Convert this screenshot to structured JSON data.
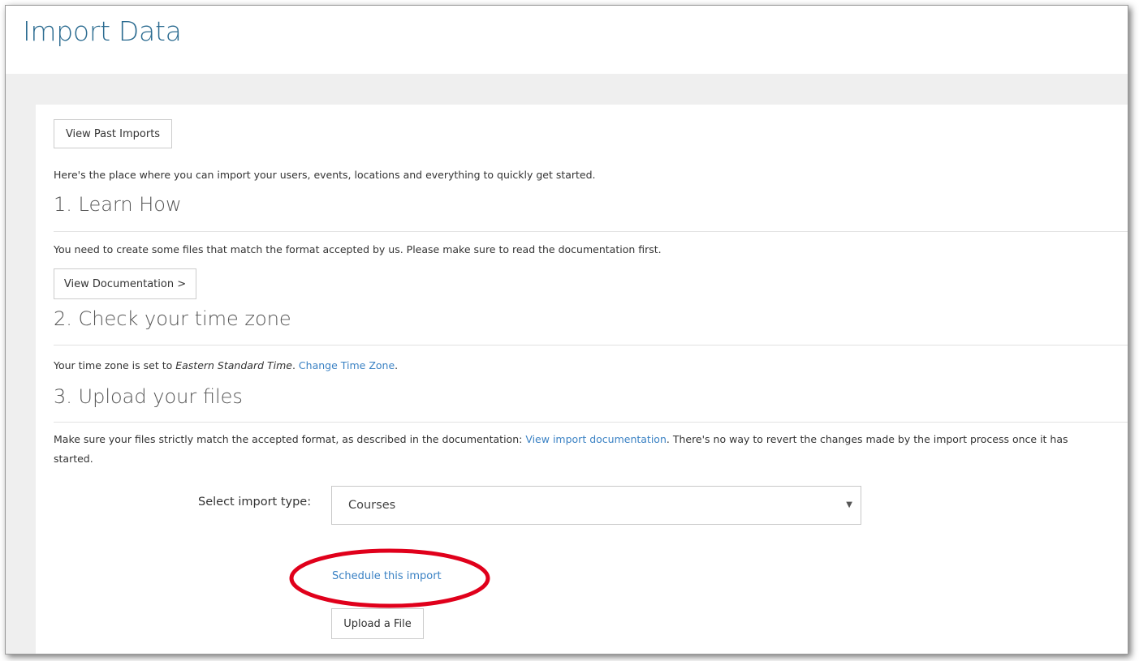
{
  "page": {
    "title": "Import Data"
  },
  "toolbar": {
    "view_past_imports_label": "View Past Imports"
  },
  "intro": {
    "text": "Here's the place where you can import your users, events, locations and everything to quickly get started."
  },
  "section_learn": {
    "heading": "1. Learn How",
    "text": "You need to create some files that match the format accepted by us. Please make sure to read the documentation first.",
    "button_label": "View Documentation >"
  },
  "section_timezone": {
    "heading": "2. Check your time zone",
    "prefix": "Your time zone is set to ",
    "timezone": "Eastern Standard Time",
    "separator": ". ",
    "change_link": "Change Time Zone",
    "suffix": "."
  },
  "section_upload": {
    "heading": "3. Upload your files",
    "text_before_link": "Make sure your files strictly match the accepted format, as described in the documentation: ",
    "doc_link": "View import documentation",
    "text_after_link": ". There's no way to revert the changes made by the import process once it has",
    "text_line2": "started.",
    "select_label": "Select import type:",
    "select_value": "Courses",
    "schedule_link": "Schedule this import",
    "upload_button": "Upload a File"
  },
  "colors": {
    "title": "#2c6c91",
    "link": "#3b82c4",
    "annotation": "#e0001b",
    "background_gray": "#efefef"
  },
  "icons": {
    "select_caret": "caret-down-icon"
  }
}
